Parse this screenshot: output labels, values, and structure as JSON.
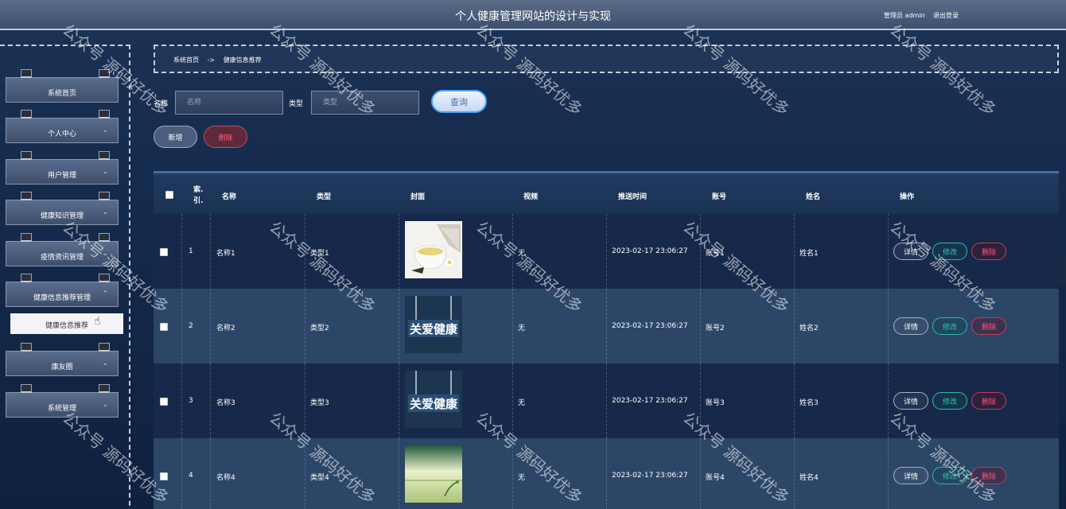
{
  "header": {
    "title": "个人健康管理网站的设计与实现",
    "user": "管理员 admin",
    "logout": "退出登录"
  },
  "sidebar": {
    "items": [
      {
        "label": "系统首页",
        "has_chevron": false
      },
      {
        "label": "个人中心",
        "has_chevron": true
      },
      {
        "label": "用户管理",
        "has_chevron": true
      },
      {
        "label": "健康知识管理",
        "has_chevron": true
      },
      {
        "label": "疫情资讯管理",
        "has_chevron": true
      },
      {
        "label": "健康信息推荐管理",
        "has_chevron": true,
        "expanded": true
      },
      {
        "label": "康友圈",
        "has_chevron": true
      },
      {
        "label": "系统管理",
        "has_chevron": true
      }
    ],
    "submenu_active": "健康信息推荐"
  },
  "breadcrumb": {
    "home": "系统首页",
    "separator": "->",
    "current": "健康信息推荐"
  },
  "search": {
    "name_label": "名称",
    "name_placeholder": "名称",
    "type_label": "类型",
    "type_placeholder": "类型",
    "query_button": "查询"
  },
  "actions": {
    "add_button": "新增",
    "delete_button": "删除"
  },
  "table": {
    "columns": [
      "索引",
      "名称",
      "类型",
      "封面",
      "视频",
      "推送时间",
      "账号",
      "姓名",
      "操作"
    ],
    "index_header_line1": "索",
    "index_header_line2": "引",
    "rows": [
      {
        "index": "1",
        "name": "名称1",
        "type": "类型1",
        "video": "无",
        "time": "2023-02-17 23:06:27",
        "account": "账号1",
        "realname": "姓名1",
        "cover": "tea-cup-image"
      },
      {
        "index": "2",
        "name": "名称2",
        "type": "类型2",
        "video": "无",
        "time": "2023-02-17 23:06:27",
        "account": "账号2",
        "realname": "姓名2",
        "cover": "care-health-sign-image"
      },
      {
        "index": "3",
        "name": "名称3",
        "type": "类型3",
        "video": "无",
        "time": "2023-02-17 23:06:27",
        "account": "账号3",
        "realname": "姓名3",
        "cover": "care-health-sign-image"
      },
      {
        "index": "4",
        "name": "名称4",
        "type": "类型4",
        "video": "无",
        "time": "2023-02-17 23:06:27",
        "account": "账号4",
        "realname": "姓名4",
        "cover": "green-landscape-image"
      }
    ],
    "op_detail": "详情",
    "op_edit": "修改",
    "op_delete": "删除"
  },
  "cover_text": "关爱健康",
  "watermark": "公众号 源码好优多",
  "colors": {
    "header_bg": "#4a5c7a",
    "page_bg": "#16294a",
    "row_dark": "#17294a",
    "row_light": "#2c4668",
    "query_border": "#4aa2ff",
    "edit_accent": "#33c4b2",
    "delete_accent": "#ff5577"
  }
}
